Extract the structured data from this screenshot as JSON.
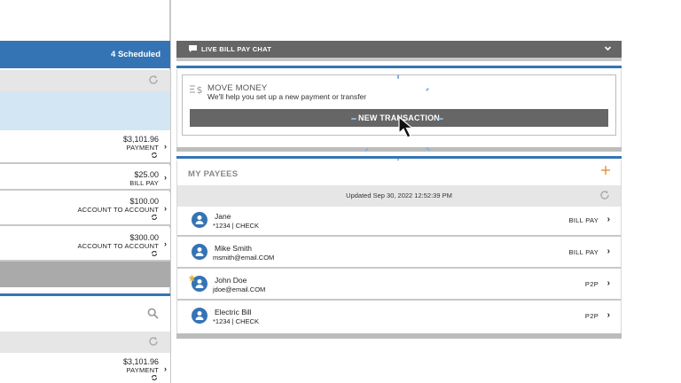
{
  "scheduled": {
    "header_label": "4 Scheduled",
    "rows": [
      {
        "amount": "$3,101.96",
        "type": "PAYMENT",
        "recurring": true
      },
      {
        "amount": "$25.00",
        "type": "BILL PAY",
        "recurring": false
      },
      {
        "amount": "$100.00",
        "type": "ACCOUNT TO ACCOUNT",
        "recurring": true
      },
      {
        "amount": "$300.00",
        "type": "ACCOUNT TO ACCOUNT",
        "recurring": true
      }
    ]
  },
  "lower_left": {
    "rows": [
      {
        "amount": "$3,101.96",
        "type": "PAYMENT",
        "recurring": true
      }
    ]
  },
  "chat": {
    "label": "LIVE BILL PAY CHAT"
  },
  "move_money": {
    "title": "MOVE MONEY",
    "subtitle": "We'll help you set up a new payment or transfer",
    "button_label": "NEW TRANSACTION"
  },
  "payees": {
    "title": "MY PAYEES",
    "updated": "Updated Sep 30, 2022 12:52:39 PM",
    "items": [
      {
        "name": "Jane",
        "detail": "*1234 | CHECK",
        "type": "BILL PAY",
        "favorite": false
      },
      {
        "name": "Mike Smith",
        "detail": "msmith@email.COM",
        "type": "BILL PAY",
        "favorite": false
      },
      {
        "name": "John Doe",
        "detail": "jdoe@email.COM",
        "type": "P2P",
        "favorite": true
      },
      {
        "name": "Electric Bill",
        "detail": "*1234 | CHECK",
        "type": "P2P",
        "favorite": false
      }
    ]
  },
  "colors": {
    "primary_blue": "#3474b4",
    "dark_gray": "#666666",
    "add_orange": "#e0913a",
    "favorite_star": "#e8b43a"
  },
  "icons": [
    "refresh-icon",
    "search-icon",
    "chat-icon",
    "chevron-down-icon",
    "move-money-icon",
    "add-icon",
    "person-icon",
    "recurring-icon",
    "star-icon",
    "chevron-right-icon",
    "cursor-icon"
  ]
}
